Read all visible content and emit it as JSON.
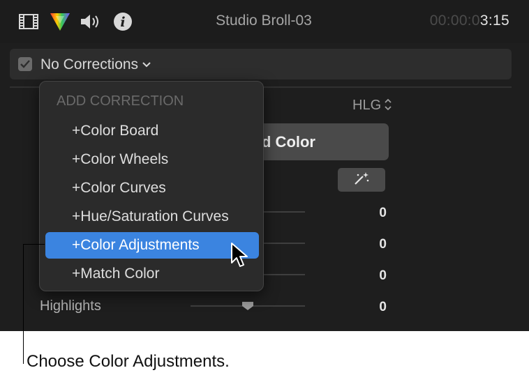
{
  "topbar": {
    "icons": [
      "film-icon",
      "color-triangle-icon",
      "speaker-icon",
      "info-icon"
    ],
    "clip_name": "Studio Broll-03",
    "timecode_dim": "00:00:0",
    "timecode_live": "3:15"
  },
  "corrections": {
    "label": "No Corrections",
    "checked": true
  },
  "panel": {
    "hdr_mode": "HLG",
    "match_color_label": "d Color",
    "sliders": [
      {
        "value": "0"
      },
      {
        "value": "0"
      },
      {
        "value": "0"
      },
      {
        "label": "Highlights",
        "value": "0"
      }
    ]
  },
  "menu": {
    "header": "ADD CORRECTION",
    "items": [
      {
        "label": "+Color Board"
      },
      {
        "label": "+Color Wheels"
      },
      {
        "label": "+Color Curves"
      },
      {
        "label": "+Hue/Saturation Curves"
      },
      {
        "label": "+Color Adjustments",
        "selected": true
      },
      {
        "label": "+Match Color"
      }
    ]
  },
  "callout": "Choose Color Adjustments.",
  "colors": {
    "selection": "#3b84e0",
    "background": "#1e1e1e"
  }
}
